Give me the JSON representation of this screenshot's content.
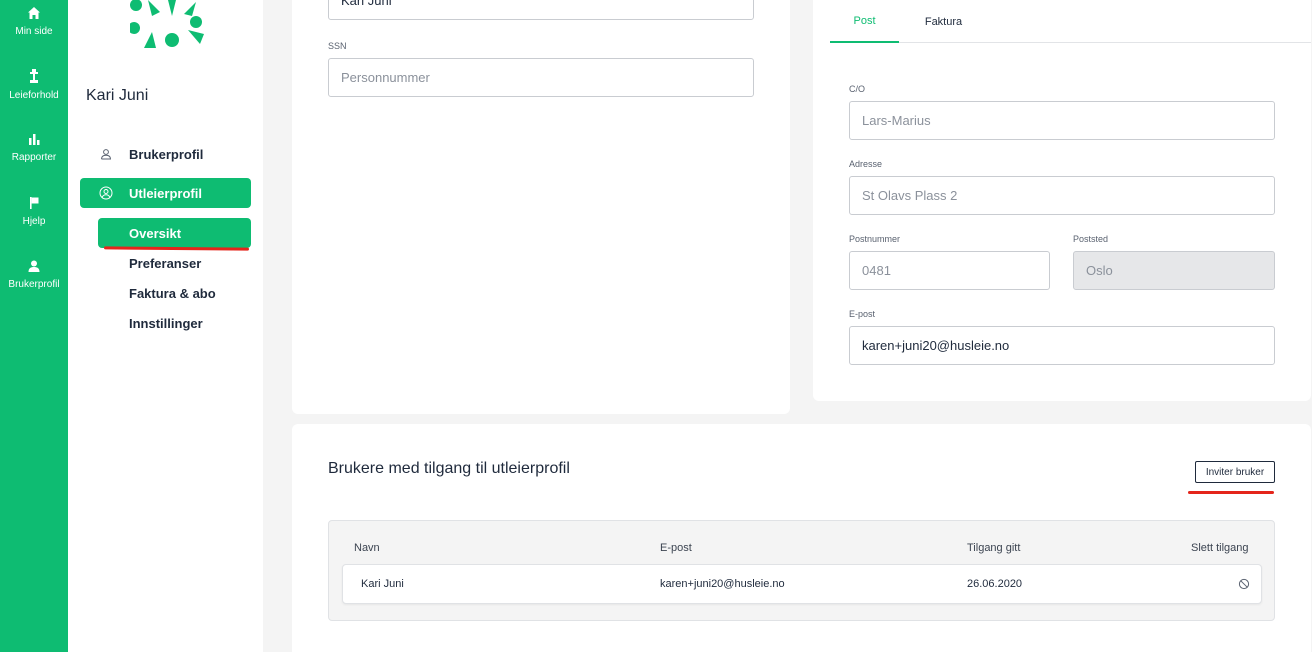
{
  "nav_rail": {
    "items": [
      {
        "label": "Min side",
        "icon": "home-icon"
      },
      {
        "label": "Leieforhold",
        "icon": "lamp-icon"
      },
      {
        "label": "Rapporter",
        "icon": "bar-chart-icon"
      },
      {
        "label": "Hjelp",
        "icon": "flag-icon"
      },
      {
        "label": "Brukerprofil",
        "icon": "user-icon"
      }
    ]
  },
  "sidebar": {
    "user_name": "Kari Juni",
    "items": [
      {
        "label": "Brukerprofil",
        "icon": "user-outline-icon"
      },
      {
        "label": "Utleierprofil",
        "icon": "user-circle-icon",
        "active": true
      }
    ],
    "subitems": [
      {
        "label": "Oversikt",
        "active": true
      },
      {
        "label": "Preferanser"
      },
      {
        "label": "Faktura & abo"
      },
      {
        "label": "Innstillinger"
      }
    ]
  },
  "profile_form": {
    "name_value": "Kari Juni",
    "ssn_label": "SSN",
    "ssn_placeholder": "Personnummer"
  },
  "address_panel": {
    "tabs": [
      {
        "label": "Post",
        "active": true
      },
      {
        "label": "Faktura"
      }
    ],
    "co_label": "C/O",
    "co_value": "Lars-Marius",
    "address_label": "Adresse",
    "address_value": "St Olavs Plass 2",
    "postnr_label": "Postnummer",
    "postnr_value": "0481",
    "poststed_label": "Poststed",
    "poststed_value": "Oslo",
    "email_label": "E-post",
    "email_value": "karen+juni20@husleie.no"
  },
  "access": {
    "title": "Brukere med tilgang til utleierprofil",
    "invite_label": "Inviter bruker",
    "columns": [
      "Navn",
      "E-post",
      "Tilgang gitt",
      "Slett tilgang"
    ],
    "rows": [
      {
        "name": "Kari Juni",
        "email": "karen+juni20@husleie.no",
        "date": "26.06.2020"
      }
    ]
  },
  "colors": {
    "brand_green": "#0ebc72",
    "annotation_red": "#e4251b"
  }
}
